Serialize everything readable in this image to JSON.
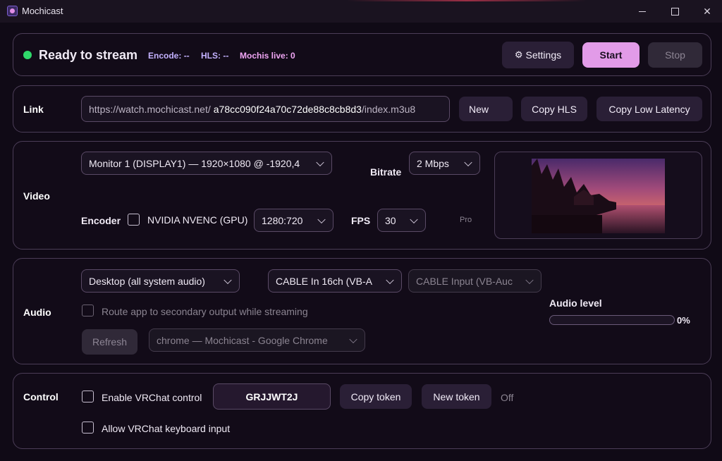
{
  "window": {
    "title": "Mochicast"
  },
  "header": {
    "status": "Ready to stream",
    "encode_label": "Encode:",
    "encode_value": "--",
    "hls_label": "HLS:",
    "hls_value": "--",
    "mochis_label": "Mochis live:",
    "mochis_value": "0",
    "settings_label": "Settings",
    "start_label": "Start",
    "stop_label": "Stop",
    "colors": {
      "status_dot": "#2fd86a",
      "encode": "#c4b2ff",
      "hls": "#c4b2ff",
      "mochis": "#f0a6f4",
      "accent": "#e29be8"
    }
  },
  "link": {
    "label": "Link",
    "prefix": "https://watch.mochicast.net/",
    "id": "a78cc090f24a70c72de88c8cb8d3",
    "suffix": "/index.m3u8",
    "new_label": "New",
    "copy_hls_label": "Copy HLS",
    "copy_low_latency_label": "Copy Low Latency"
  },
  "video": {
    "label": "Video",
    "monitor": "Monitor 1 (DISPLAY1) — 1920×1080 @ -1920,4",
    "bitrate_label": "Bitrate",
    "bitrate": "2 Mbps",
    "encoder_label": "Encoder",
    "encoder": "NVIDIA NVENC (GPU)",
    "resolution": "1280:720",
    "fps_label": "FPS",
    "fps": "30",
    "pro_label": "Pro"
  },
  "audio": {
    "label": "Audio",
    "source": "Desktop (all system audio)",
    "output_device": "CABLE In 16ch (VB-A",
    "input_device": "CABLE Input (VB-Auc",
    "route_label": "Route app to secondary output while streaming",
    "refresh_label": "Refresh",
    "app_select": "chrome — Mochicast - Google Chrome",
    "level_label": "Audio level",
    "level_value": "0%",
    "level_fraction": 0
  },
  "control": {
    "label": "Control",
    "enable_label": "Enable VRChat control",
    "token": "GRJJWT2J",
    "copy_token_label": "Copy token",
    "new_token_label": "New token",
    "status": "Off",
    "keyboard_label": "Allow VRChat keyboard input"
  }
}
